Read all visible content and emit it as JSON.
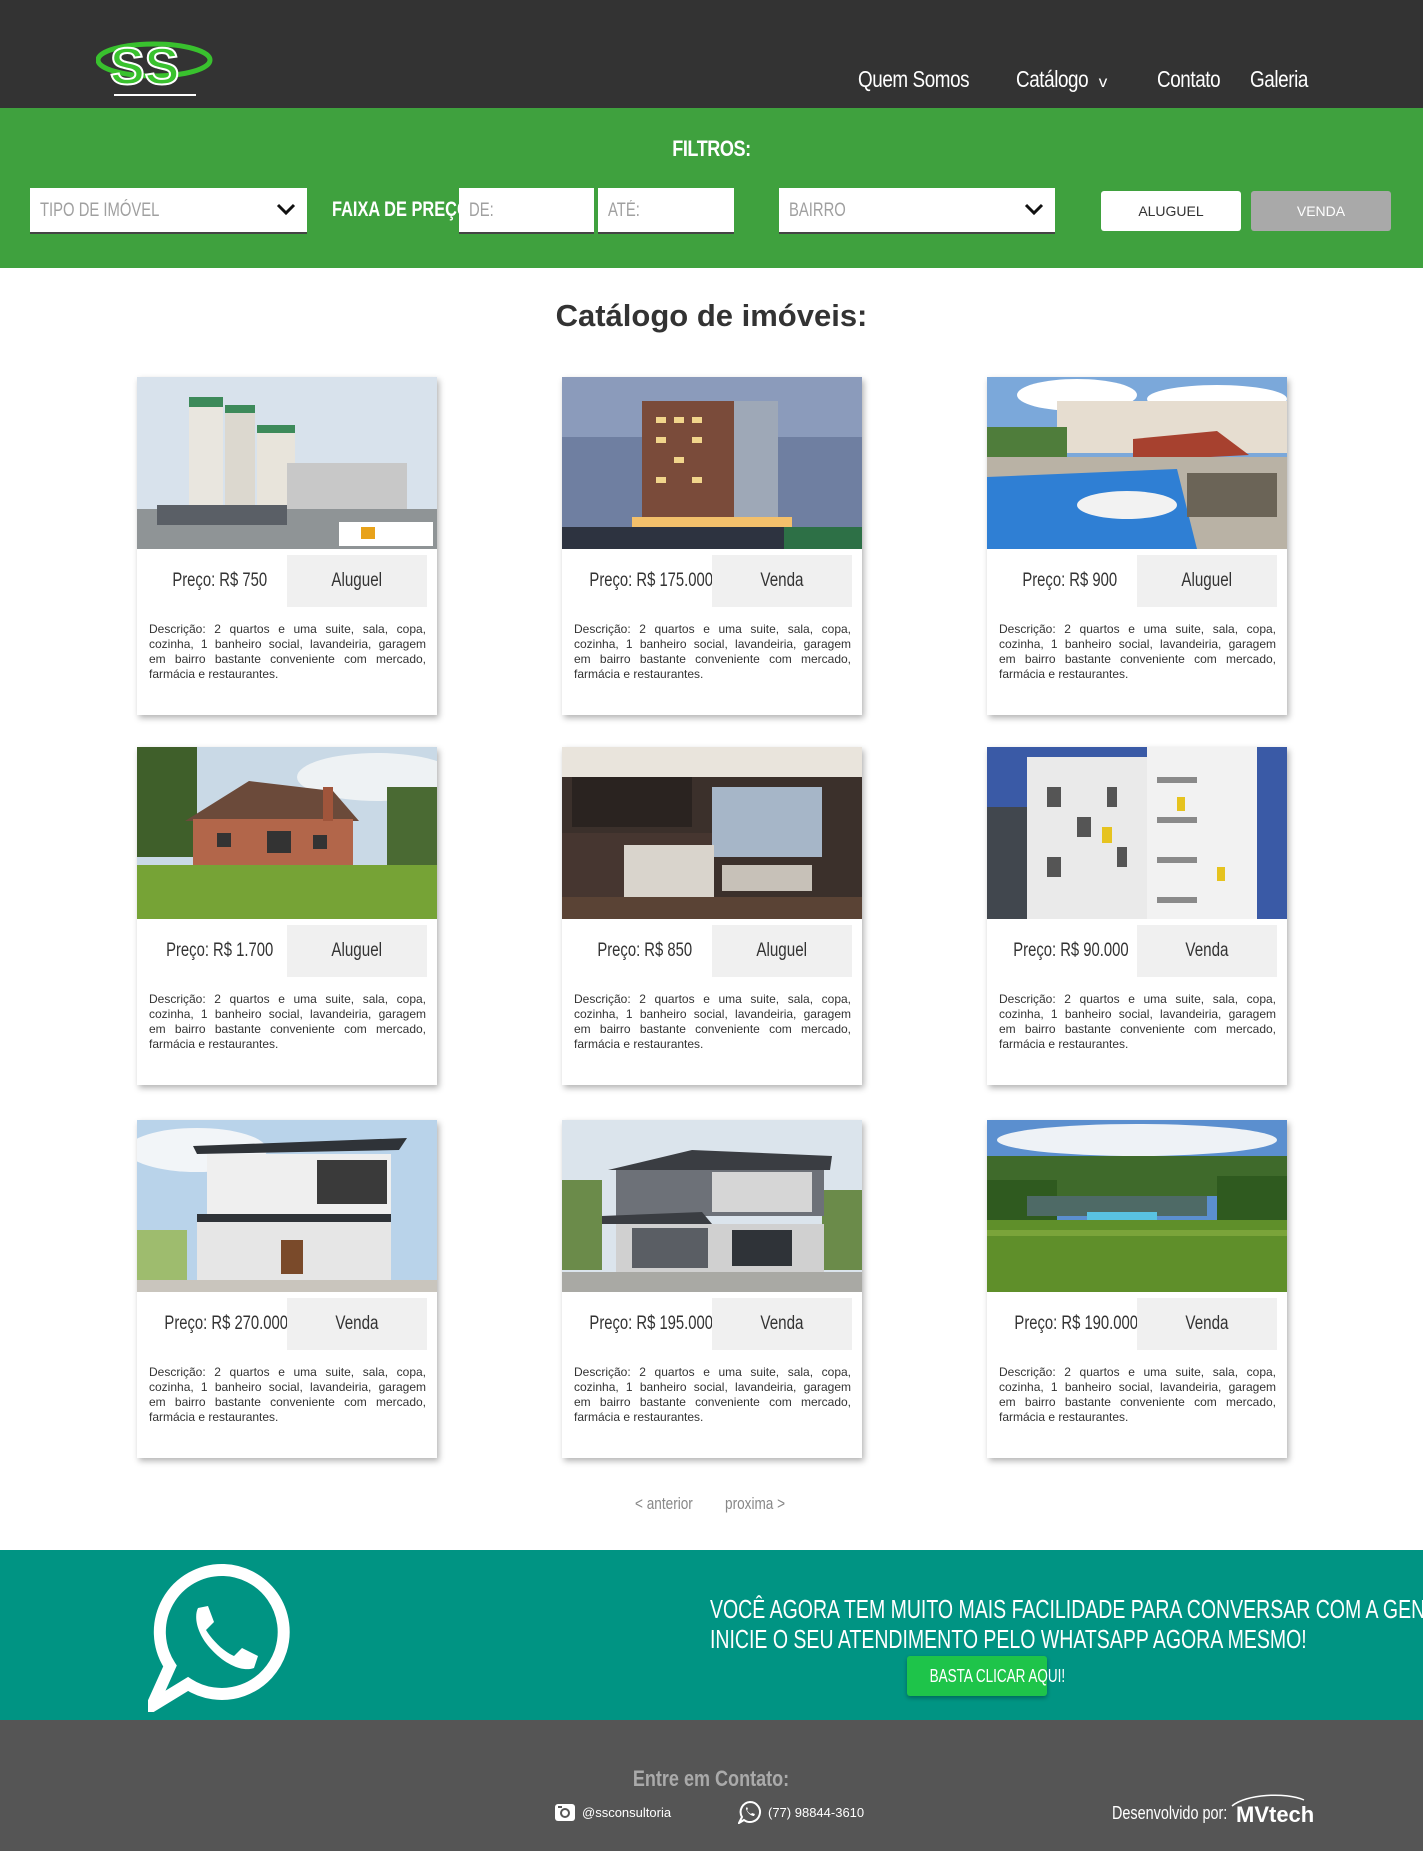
{
  "header": {
    "logo_text": "SS",
    "nav": {
      "quem_somos": "Quem Somos",
      "catalogo": "Catálogo",
      "catalogo_caret": "v",
      "contato": "Contato",
      "galeria": "Galeria"
    }
  },
  "filters": {
    "title": "FILTROS:",
    "tipo_placeholder": "TIPO DE IMÓVEL",
    "faixa_label": "FAIXA DE PREÇO:",
    "de_placeholder": "DE:",
    "ate_placeholder": "ATÉ:",
    "bairro_placeholder": "BAIRRO",
    "aluguel_button": "ALUGUEL",
    "venda_button": "VENDA"
  },
  "catalog": {
    "title": "Catálogo de imóveis:",
    "items": [
      {
        "price": "Preço: R$ 750",
        "kind": "Aluguel",
        "description": "Descrição: 2 quartos e uma suite, sala, copa, cozinha, 1 banheiro social, lavandeiria, garagem em bairro bastante conveniente com mercado, farmácia e restaurantes."
      },
      {
        "price": "Preço: R$ 175.000",
        "kind": "Venda",
        "description": "Descrição: 2 quartos e uma suite, sala, copa, cozinha, 1 banheiro social, lavandeiria, garagem em bairro bastante conveniente com mercado, farmácia e restaurantes."
      },
      {
        "price": "Preço: R$ 900",
        "kind": "Aluguel",
        "description": "Descrição: 2 quartos e uma suite, sala, copa, cozinha, 1 banheiro social, lavandeiria, garagem em bairro bastante conveniente com mercado, farmácia e restaurantes."
      },
      {
        "price": "Preço: R$ 1.700",
        "kind": "Aluguel",
        "description": "Descrição: 2 quartos e uma suite, sala, copa, cozinha, 1 banheiro social, lavandeiria, garagem em bairro bastante conveniente com mercado, farmácia e restaurantes."
      },
      {
        "price": "Preço: R$ 850",
        "kind": "Aluguel",
        "description": "Descrição: 2 quartos e uma suite, sala, copa, cozinha, 1 banheiro social, lavandeiria, garagem em bairro bastante conveniente com mercado, farmácia e restaurantes."
      },
      {
        "price": "Preço: R$ 90.000",
        "kind": "Venda",
        "description": "Descrição: 2 quartos e uma suite, sala, copa, cozinha, 1 banheiro social, lavandeiria, garagem em bairro bastante conveniente com mercado, farmácia e restaurantes."
      },
      {
        "price": "Preço: R$ 270.000",
        "kind": "Venda",
        "description": "Descrição: 2 quartos e uma suite, sala, copa, cozinha, 1 banheiro social, lavandeiria, garagem em bairro bastante conveniente com mercado, farmácia e restaurantes."
      },
      {
        "price": "Preço: R$ 195.000",
        "kind": "Venda",
        "description": "Descrição: 2 quartos e uma suite, sala, copa, cozinha, 1 banheiro social, lavandeiria, garagem em bairro bastante conveniente com mercado, farmácia e restaurantes."
      },
      {
        "price": "Preço: R$ 190.000",
        "kind": "Venda",
        "description": "Descrição: 2 quartos e uma suite, sala, copa, cozinha, 1 banheiro social, lavandeiria, garagem em bairro bastante conveniente com mercado, farmácia e restaurantes."
      }
    ],
    "pager_prev": "< anterior",
    "pager_next": "proxima >"
  },
  "whatsapp": {
    "line1": "VOCÊ AGORA TEM MUITO MAIS FACILIDADE PARA CONVERSAR COM A GENTE!",
    "line2": "INICIE O SEU ATENDIMENTO PELO WHATSAPP AGORA MESMO!",
    "button": "BASTA CLICAR AQUI!"
  },
  "footer": {
    "contact_title": "Entre em Contato:",
    "instagram": "@ssconsultoria",
    "phone": "(77) 98844-3610",
    "developed_by": "Desenvolvido por:",
    "developer": "MVtech"
  },
  "colors": {
    "header_bg": "#333333",
    "filter_bg": "#3fa13e",
    "whatsapp_bg": "#009483",
    "whatsapp_button": "#1ec44a",
    "footer_bg": "#555555",
    "brand_green": "#39c12e"
  }
}
